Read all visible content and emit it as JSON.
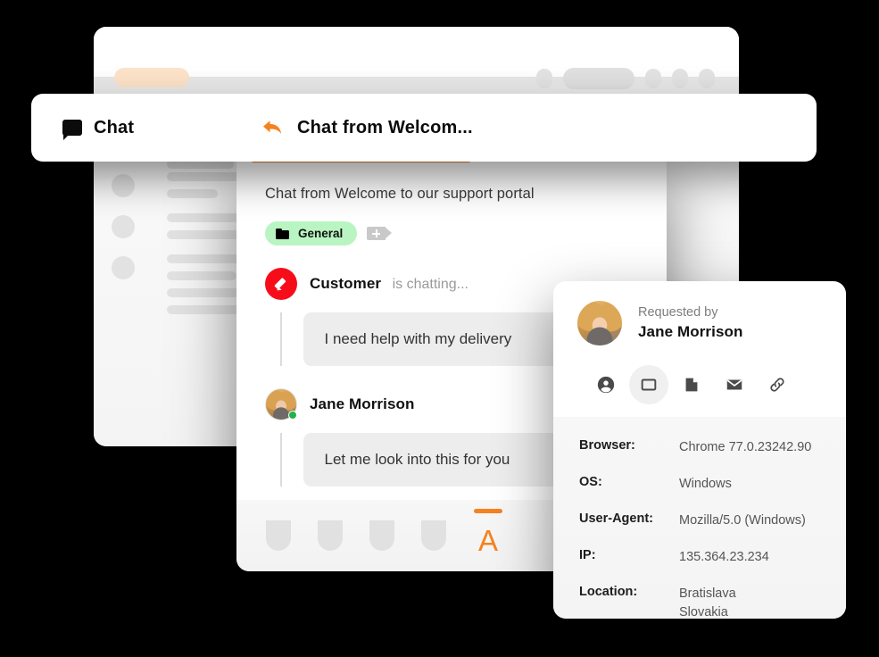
{
  "browser_window": {
    "url_pill": "",
    "skeleton_rows": [
      {
        "lines": [
          108,
          112,
          75
        ]
      },
      {
        "lines": [
          126,
          57
        ]
      },
      {
        "lines": [
          101,
          126
        ]
      },
      {
        "lines": [
          113,
          78,
          100,
          120
        ]
      }
    ]
  },
  "tabbar": {
    "chat_tab_label": "Chat",
    "chat_icon": "speech-bubble-icon",
    "active_tab_label": "Chat from Welcom...",
    "active_tab_icon": "reply-arrow-icon"
  },
  "conversation": {
    "subject": "Chat from Welcome to our support portal",
    "tag": {
      "label": "General",
      "icon": "folder-icon",
      "color": "#b9f5c2"
    },
    "add_tag_icon": "plus-icon",
    "messages": [
      {
        "sender": "Customer",
        "status": "is chatting...",
        "avatar": "pencil-icon",
        "avatar_color": "#f70d1a",
        "text": "I need help with my delivery"
      },
      {
        "sender": "Jane Morrison",
        "status": "",
        "avatar": "photo-avatar",
        "online": true,
        "text": "Let me look into this for you"
      }
    ],
    "toolbar": {
      "placeholders": 4,
      "active_letter": "A",
      "accent_color": "#f58220"
    }
  },
  "info_panel": {
    "requested_by_label": "Requested by",
    "requester_name": "Jane Morrison",
    "icons": [
      {
        "name": "person-icon",
        "active": false
      },
      {
        "name": "browser-window-icon",
        "active": true
      },
      {
        "name": "file-icon",
        "active": false
      },
      {
        "name": "envelope-icon",
        "active": false
      },
      {
        "name": "link-icon",
        "active": false
      }
    ],
    "details": [
      {
        "key": "Browser:",
        "value": "Chrome 77.0.23242.90"
      },
      {
        "key": "OS:",
        "value": "Windows"
      },
      {
        "key": "User-Agent:",
        "value": "Mozilla/5.0 (Windows)"
      },
      {
        "key": "IP:",
        "value": "135.364.23.234"
      },
      {
        "key": "Location:",
        "value": "Bratislava\nSlovakia"
      }
    ]
  }
}
